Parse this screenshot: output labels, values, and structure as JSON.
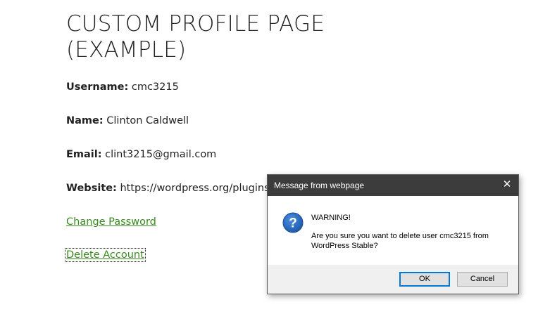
{
  "page": {
    "title": "CUSTOM PROFILE PAGE (EXAMPLE)",
    "fields": {
      "username": {
        "label": "Username:",
        "value": "cmc3215"
      },
      "name": {
        "label": "Name:",
        "value": "Clinton Caldwell"
      },
      "email": {
        "label": "Email:",
        "value": "clint3215@gmail.com"
      },
      "website": {
        "label": "Website:",
        "value": "https://wordpress.org/plugins/"
      }
    },
    "links": {
      "change_password": "Change Password",
      "delete_account": "Delete Account"
    }
  },
  "dialog": {
    "title": "Message from webpage",
    "close_glyph": "✕",
    "icon": "question-icon",
    "warning": "WARNING!",
    "question": "Are you sure you want to delete user cmc3215 from WordPress Stable?",
    "ok_label": "OK",
    "cancel_label": "Cancel"
  },
  "colors": {
    "link": "#3a8a1f",
    "titlebar": "#3c3c3c",
    "icon_blue": "#1e63b8",
    "ok_border": "#0078d7"
  }
}
